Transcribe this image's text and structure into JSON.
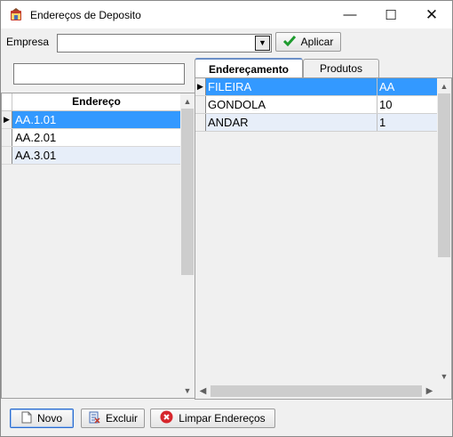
{
  "window": {
    "title": "Endereços de Deposito"
  },
  "toolbar": {
    "empresa_label": "Empresa",
    "empresa_value": "",
    "aplicar_label": "Aplicar"
  },
  "search": {
    "value": ""
  },
  "left_grid": {
    "column_header": "Endereço",
    "rows": [
      {
        "value": "AA.1.01"
      },
      {
        "value": "AA.2.01"
      },
      {
        "value": "AA.3.01"
      }
    ]
  },
  "tabs": [
    {
      "label": "Endereçamento"
    },
    {
      "label": "Produtos"
    }
  ],
  "right_grid": {
    "rows": [
      {
        "name": "FILEIRA",
        "value": "AA"
      },
      {
        "name": "GONDOLA",
        "value": "10"
      },
      {
        "name": "ANDAR",
        "value": "1"
      }
    ]
  },
  "buttons": {
    "novo": "Novo",
    "excluir": "Excluir",
    "limpar": "Limpar Endereços"
  },
  "colors": {
    "selection": "#3399ff",
    "row_alt": "#e7eef9",
    "check": "#1e9b2e",
    "cancel_red": "#d6262c"
  }
}
